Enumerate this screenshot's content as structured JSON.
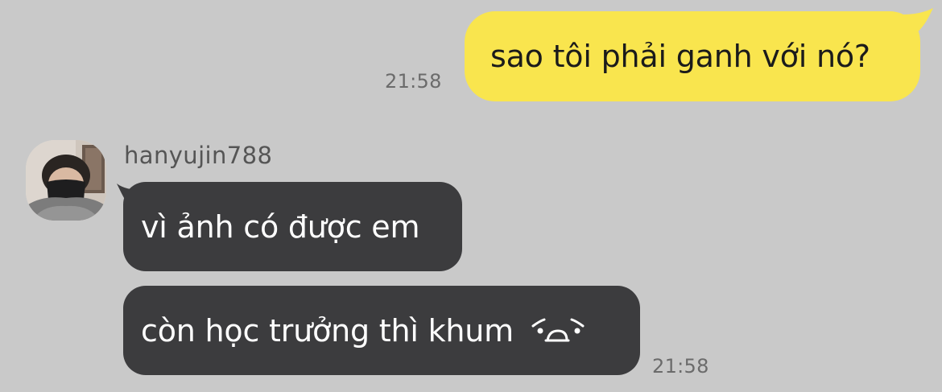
{
  "messages": {
    "outgoing": {
      "text": "sao tôi phải ganh với nó?",
      "time": "21:58"
    },
    "incoming": {
      "sender": "hanyujin788",
      "bubble1": "vì ảnh có được em",
      "bubble2": "còn học trưởng thì khum",
      "time": "21:58"
    }
  },
  "icons": {
    "avatar": "profile-photo",
    "emoticon": "sad-face-emoticon"
  },
  "colors": {
    "background": "#c9c9c9",
    "outgoing_bubble": "#f9e54e",
    "incoming_bubble": "#3c3c3e",
    "timestamp": "#6b6b6b"
  }
}
